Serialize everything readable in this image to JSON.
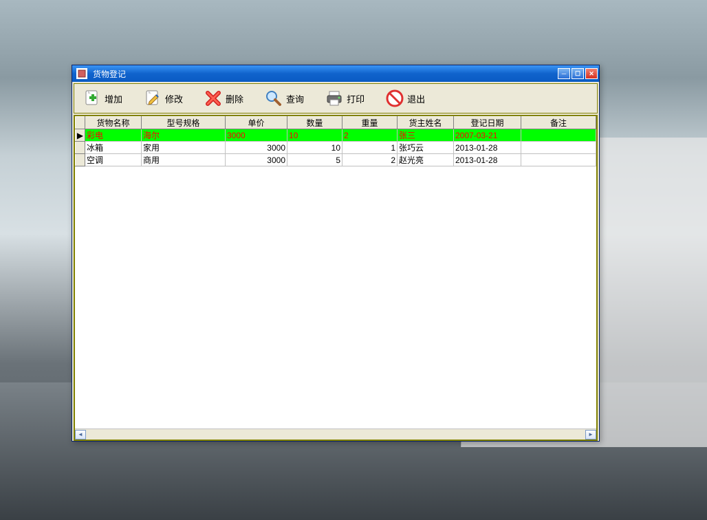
{
  "window": {
    "title": "货物登记"
  },
  "toolbar": {
    "add": "增加",
    "edit": "修改",
    "delete": "删除",
    "search": "查询",
    "print": "打印",
    "exit": "退出"
  },
  "columns": {
    "name": "货物名称",
    "spec": "型号规格",
    "price": "单价",
    "qty": "数量",
    "weight": "重量",
    "owner": "货主姓名",
    "date": "登记日期",
    "remark": "备注"
  },
  "rows": [
    {
      "selected": true,
      "indicator": "▶",
      "name": "彩电",
      "spec": "海尔",
      "price": "3000",
      "qty": "10",
      "weight": "2",
      "owner": "张三",
      "date": "2007-03-21",
      "remark": ""
    },
    {
      "selected": false,
      "indicator": "",
      "name": "冰箱",
      "spec": "家用",
      "price": "3000",
      "qty": "10",
      "weight": "1",
      "owner": "张巧云",
      "date": "2013-01-28",
      "remark": ""
    },
    {
      "selected": false,
      "indicator": "",
      "name": "空调",
      "spec": "商用",
      "price": "3000",
      "qty": "5",
      "weight": "2",
      "owner": "赵光亮",
      "date": "2013-01-28",
      "remark": ""
    }
  ]
}
